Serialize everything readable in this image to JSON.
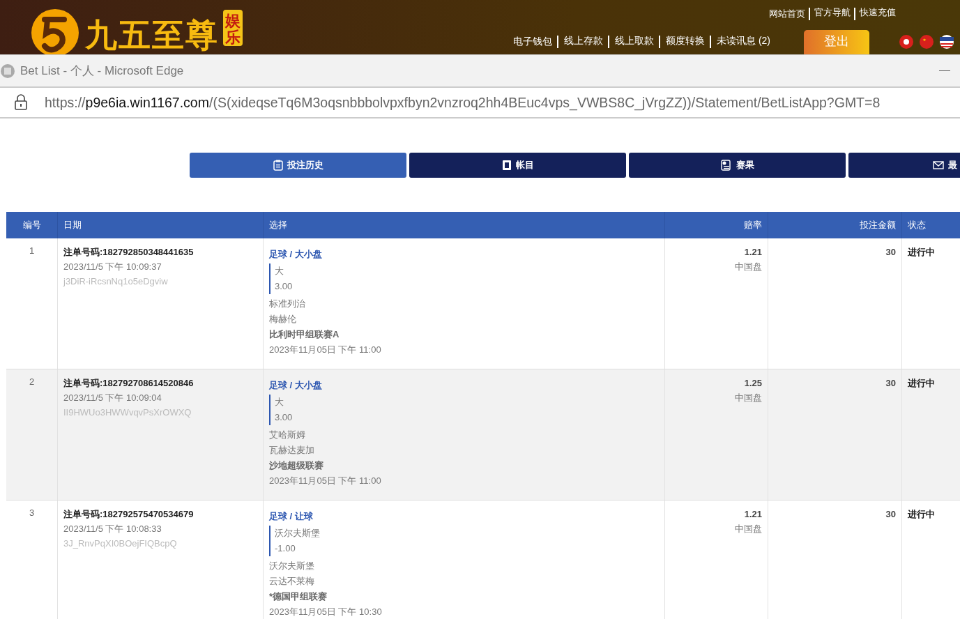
{
  "site_header": {
    "logo_text": "九五至尊",
    "logo_badge": "娱乐",
    "top_links": [
      "网站首页",
      "官方导航",
      "快速充值"
    ],
    "nav_links": [
      "电子钱包",
      "线上存款",
      "线上取款",
      "额度转换",
      "未读讯息 (2)"
    ],
    "logout_button": "登出"
  },
  "window": {
    "title": "Bet List - 个人 - Microsoft Edge",
    "url_prefix": "https://",
    "url_host": "p9e6ia.win1167.com",
    "url_path": "/(S(xideqseTq6M3oqsnbbbolvpxfbyn2vnzroq2hh4BEuc4vps_VWBS8C_jVrgZZ))/Statement/BetListApp?GMT=8"
  },
  "tabs": [
    {
      "label": "投注历史",
      "selected": true,
      "kind": "clipboard"
    },
    {
      "label": "帐目",
      "selected": false,
      "kind": "ledger"
    },
    {
      "label": "赛果",
      "selected": false,
      "kind": "result"
    },
    {
      "label": "最",
      "selected": false,
      "kind": "mail"
    }
  ],
  "table": {
    "columns": [
      "编号",
      "日期",
      "选择",
      "赔率",
      "投注金额",
      "状态"
    ],
    "rows": [
      {
        "no": "1",
        "bet_id": "注单号码:182792850348441635",
        "time": "2023/11/5 下午 10:09:37",
        "ref": "j3DiR-iRcsnNq1o5eDgviw",
        "market": "足球 / 大小盘",
        "pick": "大",
        "line": "3.00",
        "home": "标准列治",
        "away": "梅赫伦",
        "league": "比利时甲组联赛A",
        "match_time": "2023年11月05日 下午 11:00",
        "odds": "1.21",
        "odds_type": "中国盘",
        "stake": "30",
        "status": "进行中"
      },
      {
        "no": "2",
        "bet_id": "注单号码:182792708614520846",
        "time": "2023/11/5 下午 10:09:04",
        "ref": "II9HWUo3HWWvqvPsXrOWXQ",
        "market": "足球 / 大小盘",
        "pick": "大",
        "line": "3.00",
        "home": "艾哈斯姆",
        "away": "瓦赫达麦加",
        "league": "沙地超级联赛",
        "match_time": "2023年11月05日 下午 11:00",
        "odds": "1.25",
        "odds_type": "中国盘",
        "stake": "30",
        "status": "进行中"
      },
      {
        "no": "3",
        "bet_id": "注单号码:182792575470534679",
        "time": "2023/11/5 下午 10:08:33",
        "ref": "3J_RnvPqXI0BOejFIQBcpQ",
        "market": "足球 / 让球",
        "pick": "沃尔夫斯堡",
        "line": "-1.00",
        "home": "沃尔夫斯堡",
        "away": "云达不莱梅",
        "league": "*德国甲组联赛",
        "match_time": "2023年11月05日 下午 10:30",
        "odds": "1.21",
        "odds_type": "中国盘",
        "stake": "30",
        "status": "进行中"
      }
    ]
  }
}
